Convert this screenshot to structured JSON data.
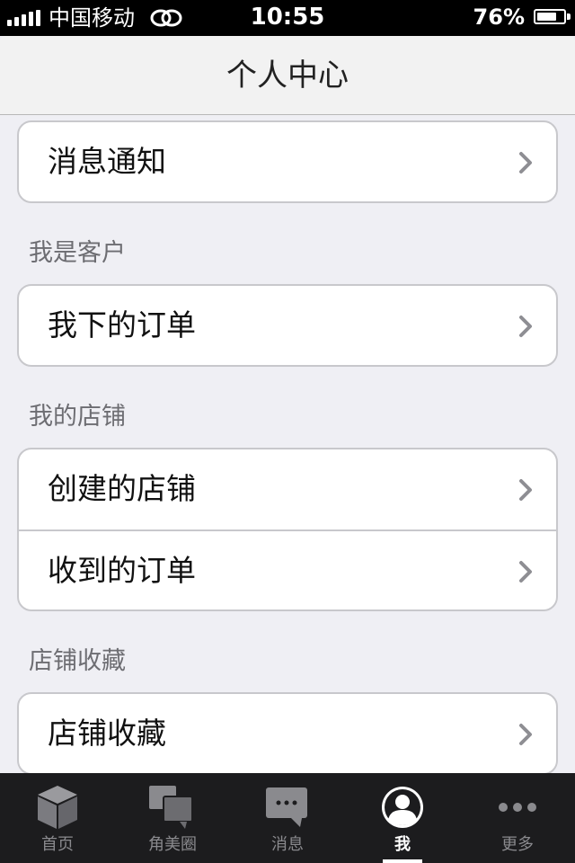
{
  "status_bar": {
    "carrier": "中国移动",
    "time": "10:55",
    "battery": "76%",
    "battery_level": 0.76
  },
  "nav": {
    "title": "个人中心"
  },
  "groups": {
    "notifications": {
      "items": [
        {
          "label": "消息通知"
        }
      ]
    },
    "customer": {
      "header": "我是客户",
      "items": [
        {
          "label": "我下的订单"
        }
      ]
    },
    "shop": {
      "header": "我的店铺",
      "items": [
        {
          "label": "创建的店铺"
        },
        {
          "label": "收到的订单"
        }
      ]
    },
    "favorites": {
      "header": "店铺收藏",
      "items": [
        {
          "label": "店铺收藏"
        }
      ]
    }
  },
  "tab_bar": {
    "tabs": [
      {
        "label": "首页",
        "icon": "cube-icon",
        "active": false
      },
      {
        "label": "角美圈",
        "icon": "chat-bubbles-icon",
        "active": false
      },
      {
        "label": "消息",
        "icon": "message-icon",
        "active": false
      },
      {
        "label": "我",
        "icon": "user-profile-icon",
        "active": true
      },
      {
        "label": "更多",
        "icon": "more-dots-icon",
        "active": false
      }
    ]
  }
}
